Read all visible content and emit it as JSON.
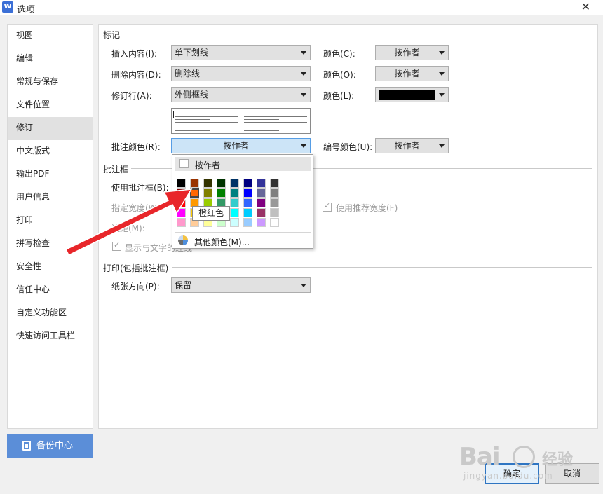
{
  "window": {
    "title": "选项",
    "app_icon_text": "W",
    "close_glyph": "✕"
  },
  "sidebar": {
    "items": [
      {
        "label": "视图"
      },
      {
        "label": "编辑"
      },
      {
        "label": "常规与保存"
      },
      {
        "label": "文件位置"
      },
      {
        "label": "修订",
        "active": true
      },
      {
        "label": "中文版式"
      },
      {
        "label": "输出PDF"
      },
      {
        "label": "用户信息"
      },
      {
        "label": "打印"
      },
      {
        "label": "拼写检查"
      },
      {
        "label": "安全性"
      },
      {
        "label": "信任中心"
      },
      {
        "label": "自定义功能区"
      },
      {
        "label": "快速访问工具栏"
      }
    ],
    "backup_label": "备份中心"
  },
  "markup": {
    "group_title": "标记",
    "insert_label": "插入内容(I):",
    "insert_value": "单下划线",
    "insert_color_label": "颜色(C):",
    "insert_color_value": "按作者",
    "delete_label": "删除内容(D):",
    "delete_value": "删除线",
    "delete_color_label": "颜色(O):",
    "delete_color_value": "按作者",
    "revline_label": "修订行(A):",
    "revline_value": "外侧框线",
    "revline_color_label": "颜色(L):",
    "revline_color": "#000000",
    "comment_color_label": "批注颜色(R):",
    "comment_color_value": "按作者",
    "number_color_label": "编号颜色(U):",
    "number_color_value": "按作者"
  },
  "comment_box": {
    "group_title": "批注框",
    "use_label": "使用批注框(B):",
    "width_label": "指定宽度(W",
    "margin_label": "边距(M):",
    "show_text_label": "显示与文字的连线",
    "recommended_width_label": "使用推荐宽度(F)"
  },
  "print": {
    "group_title": "打印(包括批注框)",
    "orientation_label": "纸张方向(P):",
    "orientation_value": "保留"
  },
  "color_popup": {
    "author_label": "按作者",
    "rows": [
      [
        "#000000",
        "#993300",
        "#333300",
        "#003300",
        "#003366",
        "#000080",
        "#333399",
        "#333333"
      ],
      [
        "#800000",
        "#ff6600",
        "#808000",
        "#008000",
        "#008080",
        "#0000ff",
        "#666699",
        "#808080"
      ],
      [
        "#ff0000",
        "#ff9900",
        "#99cc00",
        "#339966",
        "#33cccc",
        "#3366ff",
        "#800080",
        "#999999"
      ],
      [
        "#ff00ff",
        "#ffcc00",
        "#ffff00",
        "#00ff00",
        "#00ffff",
        "#00ccff",
        "#993366",
        "#c0c0c0"
      ],
      [
        "#ff99cc",
        "#ffcc99",
        "#ffff99",
        "#ccffcc",
        "#ccffff",
        "#99ccff",
        "#cc99ff",
        "#ffffff"
      ]
    ],
    "selected_row": 1,
    "selected_col": 1,
    "tooltip": "橙红色",
    "more_colors_label": "其他颜色(M)..."
  },
  "buttons": {
    "ok_label": "确定",
    "cancel_label": "取消"
  },
  "watermark": {
    "brand": "Bai",
    "brand_cn": "经验",
    "url": "jingyan.baidu.com"
  },
  "colors": {
    "annotation_arrow": "#e8262a",
    "backup_button": "#5b8ed8",
    "focus_border": "#2f75c2"
  }
}
